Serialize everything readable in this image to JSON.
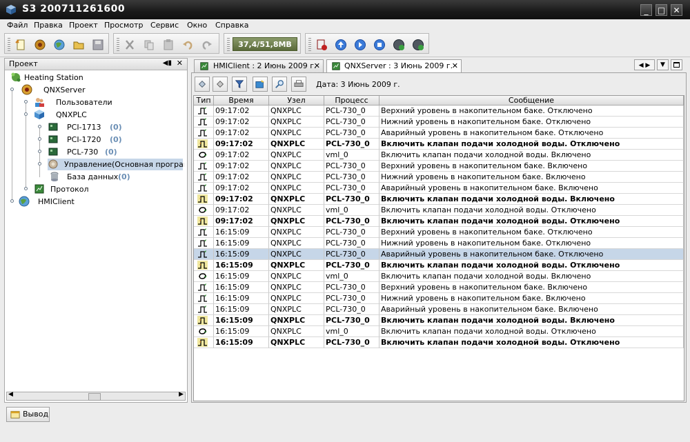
{
  "window": {
    "title": "S3 200711261600",
    "minimize": "_",
    "maximize": "□",
    "close": "✕"
  },
  "menu": [
    {
      "label": "Файл"
    },
    {
      "label": "Правка"
    },
    {
      "label": "Проект"
    },
    {
      "label": "Просмотр"
    },
    {
      "label": "Сервис"
    },
    {
      "label": "Окно"
    },
    {
      "label": "Справка"
    }
  ],
  "toolbar": {
    "memory": "37,4/51,8MB"
  },
  "left_panel": {
    "title": "Проект",
    "tree": [
      {
        "label": "Heating Station",
        "count": ""
      },
      {
        "label": "QNXServer",
        "count": ""
      },
      {
        "label": "Пользователи",
        "count": ""
      },
      {
        "label": "QNXPLC",
        "count": ""
      },
      {
        "label": "PCI-1713",
        "count": "(0)"
      },
      {
        "label": "PCI-1720",
        "count": "(0)"
      },
      {
        "label": "PCL-730",
        "count": "(0)"
      },
      {
        "label": "Управление(Основная програм",
        "count": ""
      },
      {
        "label": "База данных",
        "count": "(0)"
      },
      {
        "label": "Протокол",
        "count": ""
      },
      {
        "label": "HMIClient",
        "count": ""
      }
    ]
  },
  "tabs": [
    {
      "label": "HMIClient : 2 Июнь 2009 г."
    },
    {
      "label": "QNXServer : 3 Июнь 2009 г."
    }
  ],
  "date_label": "Дата:  3 Июнь 2009 г.",
  "columns": [
    "Тип",
    "Время",
    "Узел",
    "Процесс",
    "Сообщение"
  ],
  "rows": [
    {
      "time": "09:17:02",
      "node": "QNXPLC",
      "process": "PCL-730_0",
      "message": "Верхний уровень в накопительном баке. Отключено"
    },
    {
      "time": "09:17:02",
      "node": "QNXPLC",
      "process": "PCL-730_0",
      "message": "Нижний уровень в накопительном баке. Отключено"
    },
    {
      "time": "09:17:02",
      "node": "QNXPLC",
      "process": "PCL-730_0",
      "message": "Аварийный уровень в накопительном баке. Отключено"
    },
    {
      "time": "09:17:02",
      "node": "QNXPLC",
      "process": "PCL-730_0",
      "message": "Включить клапан подачи холодной воды. Отключено"
    },
    {
      "time": "09:17:02",
      "node": "QNXPLC",
      "process": "vml_0",
      "message": "Включить клапан подачи холодной воды. Включено"
    },
    {
      "time": "09:17:02",
      "node": "QNXPLC",
      "process": "PCL-730_0",
      "message": "Верхний уровень в накопительном баке. Включено"
    },
    {
      "time": "09:17:02",
      "node": "QNXPLC",
      "process": "PCL-730_0",
      "message": "Нижний уровень в накопительном баке. Включено"
    },
    {
      "time": "09:17:02",
      "node": "QNXPLC",
      "process": "PCL-730_0",
      "message": "Аварийный уровень в накопительном баке. Включено"
    },
    {
      "time": "09:17:02",
      "node": "QNXPLC",
      "process": "PCL-730_0",
      "message": "Включить клапан подачи холодной воды. Включено"
    },
    {
      "time": "09:17:02",
      "node": "QNXPLC",
      "process": "vml_0",
      "message": "Включить клапан подачи холодной воды. Отключено"
    },
    {
      "time": "09:17:02",
      "node": "QNXPLC",
      "process": "PCL-730_0",
      "message": "Включить клапан подачи холодной воды. Отключено"
    },
    {
      "time": "16:15:09",
      "node": "QNXPLC",
      "process": "PCL-730_0",
      "message": "Верхний уровень в накопительном баке. Отключено"
    },
    {
      "time": "16:15:09",
      "node": "QNXPLC",
      "process": "PCL-730_0",
      "message": "Нижний уровень в накопительном баке. Отключено"
    },
    {
      "time": "16:15:09",
      "node": "QNXPLC",
      "process": "PCL-730_0",
      "message": "Аварийный уровень в накопительном баке. Отключено"
    },
    {
      "time": "16:15:09",
      "node": "QNXPLC",
      "process": "PCL-730_0",
      "message": "Включить клапан подачи холодной воды. Отключено"
    },
    {
      "time": "16:15:09",
      "node": "QNXPLC",
      "process": "vml_0",
      "message": "Включить клапан подачи холодной воды. Включено"
    },
    {
      "time": "16:15:09",
      "node": "QNXPLC",
      "process": "PCL-730_0",
      "message": "Верхний уровень в накопительном баке. Включено"
    },
    {
      "time": "16:15:09",
      "node": "QNXPLC",
      "process": "PCL-730_0",
      "message": "Нижний уровень в накопительном баке. Включено"
    },
    {
      "time": "16:15:09",
      "node": "QNXPLC",
      "process": "PCL-730_0",
      "message": "Аварийный уровень в накопительном баке. Включено"
    },
    {
      "time": "16:15:09",
      "node": "QNXPLC",
      "process": "PCL-730_0",
      "message": "Включить клапан подачи холодной воды. Включено"
    },
    {
      "time": "16:15:09",
      "node": "QNXPLC",
      "process": "vml_0",
      "message": "Включить клапан подачи холодной воды. Отключено"
    },
    {
      "time": "16:15:09",
      "node": "QNXPLC",
      "process": "PCL-730_0",
      "message": "Включить клапан подачи холодной воды. Отключено"
    }
  ],
  "bottom": {
    "output_label": "Вывод"
  },
  "colors": {
    "selected_row": "#c6d6e8",
    "count_text": "#6b8fb5",
    "title_bar": "#1a1a1a"
  }
}
